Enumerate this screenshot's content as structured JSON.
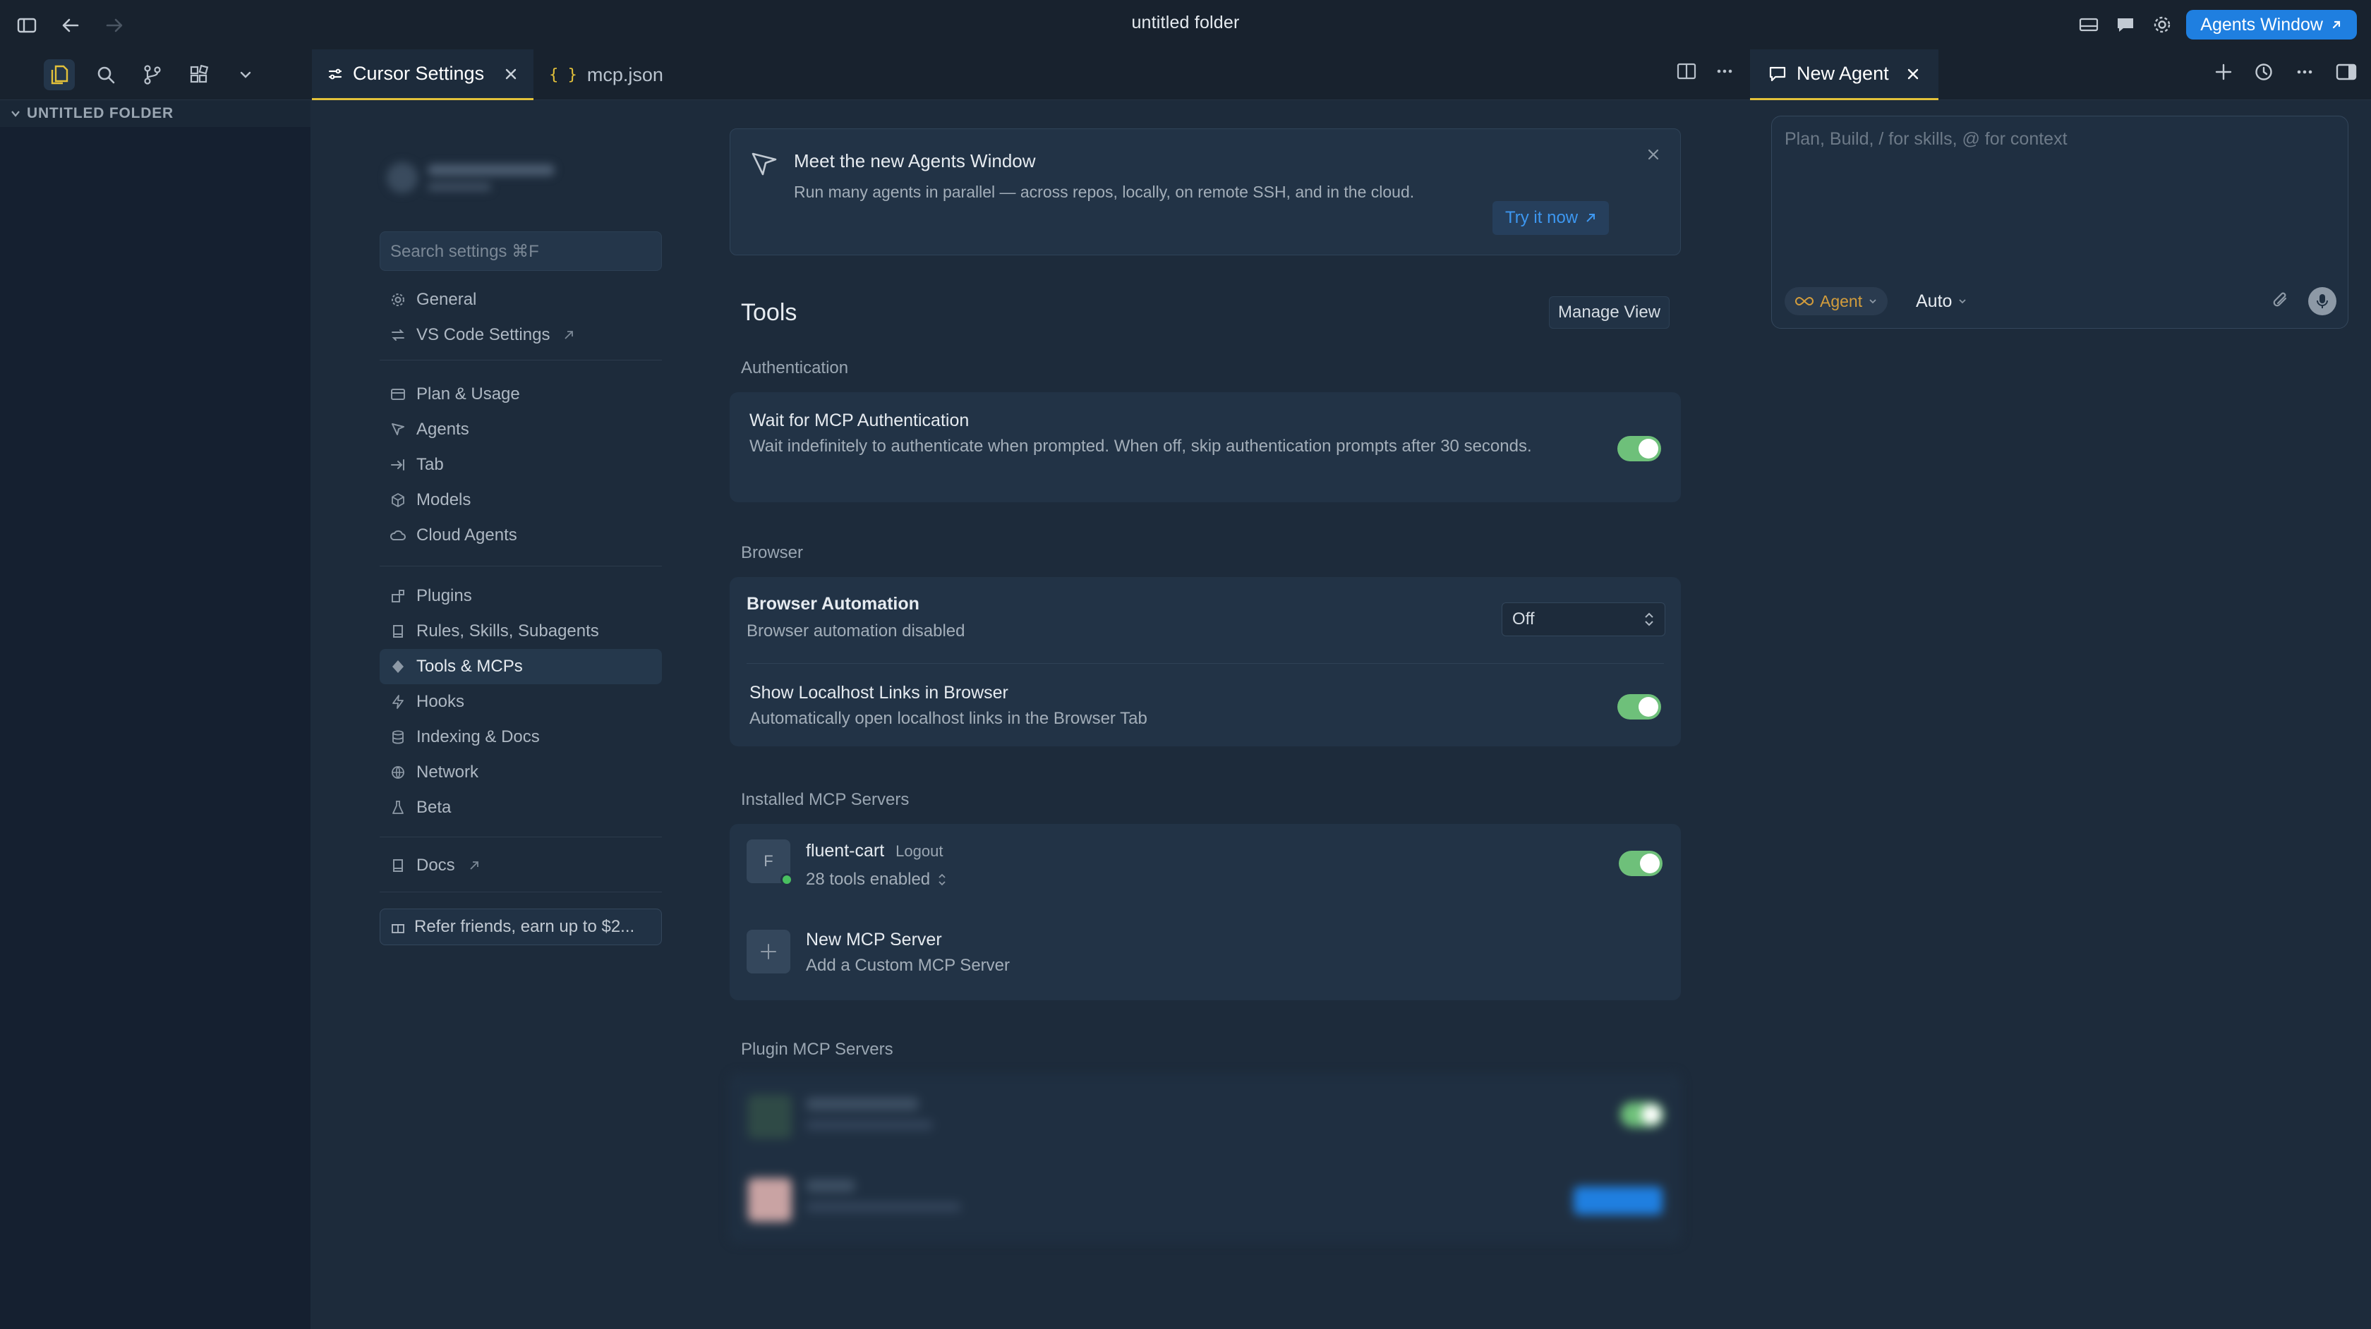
{
  "window": {
    "title": "untitled folder",
    "agents_window_label": "Agents Window"
  },
  "tabs": {
    "settings_tab": "Cursor Settings",
    "mcp_tab": "mcp.json",
    "mcp_icon": "{ }",
    "agent_tab": "New Agent"
  },
  "explorer": {
    "folder_name": "UNTITLED FOLDER"
  },
  "settings_nav": {
    "search_placeholder": "Search settings ⌘F",
    "group1": [
      {
        "label": "General",
        "icon": "gear-icon"
      },
      {
        "label": "VS Code Settings",
        "icon": "arrows-icon",
        "external": true
      }
    ],
    "group2": [
      {
        "label": "Plan & Usage",
        "icon": "card-icon"
      },
      {
        "label": "Agents",
        "icon": "agent-icon"
      },
      {
        "label": "Tab",
        "icon": "tab-icon"
      },
      {
        "label": "Models",
        "icon": "cube-icon"
      },
      {
        "label": "Cloud Agents",
        "icon": "cloud-icon"
      }
    ],
    "group3": [
      {
        "label": "Plugins",
        "icon": "plugin-icon"
      },
      {
        "label": "Rules, Skills, Subagents",
        "icon": "book-icon"
      },
      {
        "label": "Tools & MCPs",
        "icon": "tools-icon",
        "active": true
      },
      {
        "label": "Hooks",
        "icon": "bolt-icon"
      },
      {
        "label": "Indexing & Docs",
        "icon": "database-icon"
      },
      {
        "label": "Network",
        "icon": "globe-icon"
      },
      {
        "label": "Beta",
        "icon": "flask-icon"
      }
    ],
    "group4": [
      {
        "label": "Docs",
        "icon": "book-icon",
        "external": true
      }
    ],
    "refer_label": "Refer friends, earn up to $2..."
  },
  "banner": {
    "title": "Meet the new Agents Window",
    "text": "Run many agents in parallel — across repos, locally, on remote SSH, and in the cloud.",
    "cta": "Try it now"
  },
  "tools": {
    "title": "Tools",
    "manage_view": "Manage View",
    "authentication": {
      "section": "Authentication",
      "title": "Wait for MCP Authentication",
      "description": "Wait indefinitely to authenticate when prompted. When off, skip authentication prompts after 30 seconds.",
      "enabled": true
    },
    "browser": {
      "section": "Browser",
      "automation_title": "Browser Automation",
      "automation_desc": "Browser automation disabled",
      "automation_value": "Off",
      "localhost_title": "Show Localhost Links in Browser",
      "localhost_desc": "Automatically open localhost links in the Browser Tab",
      "localhost_enabled": true
    },
    "installed": {
      "section": "Installed MCP Servers",
      "server_initial": "F",
      "server_name": "fluent-cart",
      "server_action": "Logout",
      "server_tools": "28 tools enabled",
      "server_enabled": true,
      "new_title": "New MCP Server",
      "new_desc": "Add a Custom MCP Server"
    },
    "plugins": {
      "section": "Plugin MCP Servers"
    }
  },
  "agent": {
    "placeholder": "Plan, Build, / for skills, @ for context",
    "mode": "Agent",
    "model": "Auto"
  },
  "colors": {
    "accent": "#1f7fe0",
    "toggle_on": "#6ec07a",
    "active_tab_underline": "#e3c13a"
  }
}
